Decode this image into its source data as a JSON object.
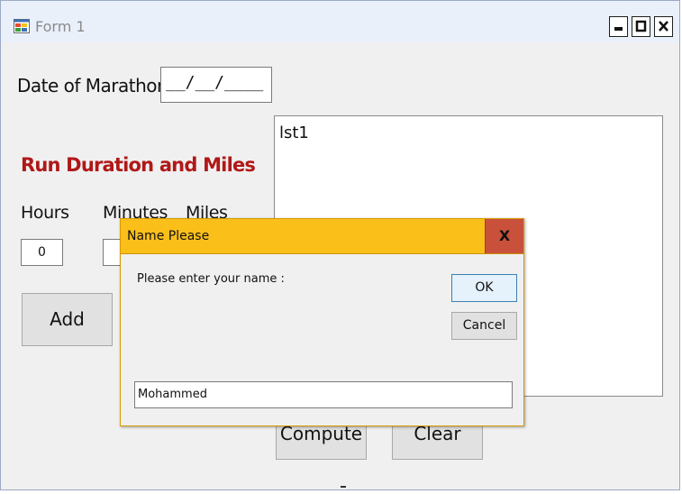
{
  "window": {
    "title": "Form 1",
    "icon": "form-app-icon",
    "controls": [
      "minimize-icon",
      "maximize-icon",
      "close-icon"
    ]
  },
  "form": {
    "date_label": "Date of Marathon",
    "date_value": "__/__/____",
    "section_heading": "Run Duration and Miles",
    "hours_label": "Hours",
    "minutes_label": "Minutes",
    "miles_label": "Miles",
    "hours_value": "0",
    "add_label": "Add",
    "list_label": "lst1",
    "compute_label": "Compute",
    "clear_label": "Clear"
  },
  "dialog": {
    "title": "Name Please",
    "close_label": "X",
    "prompt": "Please enter your name :",
    "ok_label": "OK",
    "cancel_label": "Cancel",
    "input_value": "Mohammed"
  },
  "colors": {
    "heading": "#b01818",
    "dialog_titlebar": "#fbbf1a",
    "dialog_close": "#c9513c",
    "window_bg": "#f0f0f0"
  }
}
